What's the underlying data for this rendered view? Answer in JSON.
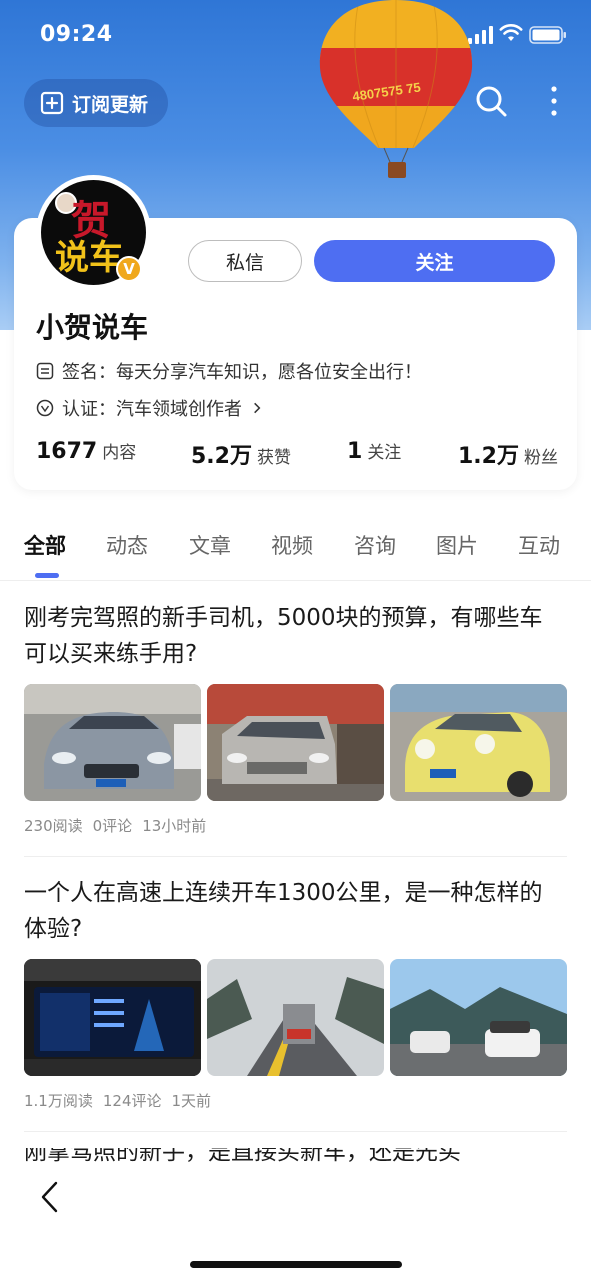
{
  "status_bar": {
    "time": "09:24"
  },
  "header": {
    "subscribe_label": "订阅更新",
    "balloon_text": "4807575 75"
  },
  "profile": {
    "avatar_text_top": "贺",
    "avatar_text_bottom": "说车",
    "verified_badge": "V",
    "dm_label": "私信",
    "follow_label": "关注",
    "nickname": "小贺说车",
    "signature": "签名：每天分享汽车知识，愿各位安全出行！",
    "certification": "认证：汽车领域创作者",
    "stats": [
      {
        "num": "1677",
        "label": "内容"
      },
      {
        "num": "5.2万",
        "label": "获赞"
      },
      {
        "num": "1",
        "label": "关注"
      },
      {
        "num": "1.2万",
        "label": "粉丝"
      }
    ]
  },
  "tabs": [
    "全部",
    "动态",
    "文章",
    "视频",
    "咨询",
    "图片",
    "互动"
  ],
  "articles": [
    {
      "title": "刚考完驾照的新手司机，5000块的预算，有哪些车可以买来练手用?",
      "reads": "230阅读",
      "comments": "0评论",
      "time": "13小时前"
    },
    {
      "title": "一个人在高速上连续开车1300公里，是一种怎样的体验?",
      "reads": "1.1万阅读",
      "comments": "124评论",
      "time": "1天前"
    }
  ],
  "partial_article_title": "刚拿驾照的新手，是直接买新车，还是先买",
  "colors": {
    "accent": "#4e6ef2",
    "sky_top": "#2f76d6",
    "meta_gray": "#8a8a8a"
  },
  "icons": [
    "signal-icon",
    "wifi-icon",
    "battery-icon",
    "subscribe-icon",
    "search-icon",
    "more-icon",
    "signature-icon",
    "certification-icon",
    "back-icon"
  ]
}
